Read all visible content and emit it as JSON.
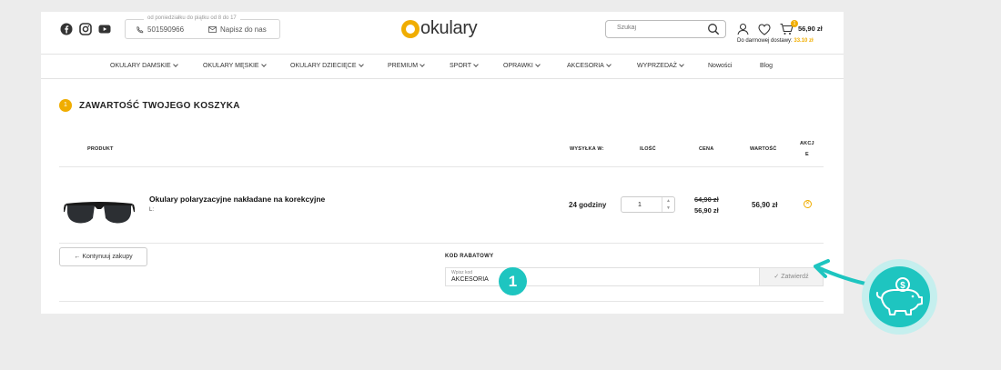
{
  "header": {
    "hours": "od poniedziałku do piątku od 8 do 17",
    "phone": "501590966",
    "mail_label": "Napisz do nas",
    "logo_text": "okulary",
    "search_placeholder": "Szukaj",
    "cart_count": "1",
    "cart_amount": "56,90 zł",
    "free_shipping_label": "Do darmowej dostawy:",
    "free_shipping_amount": "33.10 zł",
    "icons": [
      "facebook-icon",
      "instagram-icon",
      "youtube-icon",
      "phone-icon",
      "mail-icon",
      "search-icon",
      "user-icon",
      "heart-icon",
      "cart-icon"
    ]
  },
  "nav": {
    "items": [
      {
        "label": "OKULARY DAMSKIE"
      },
      {
        "label": "OKULARY MĘSKIE"
      },
      {
        "label": "OKULARY DZIECIĘCE"
      },
      {
        "label": "PREMIUM"
      },
      {
        "label": "SPORT"
      },
      {
        "label": "OPRAWKI"
      },
      {
        "label": "AKCESORIA"
      },
      {
        "label": "WYPRZEDAŻ"
      },
      {
        "label": "Nowości"
      },
      {
        "label": "Blog"
      }
    ]
  },
  "cart": {
    "step": "1",
    "title": "ZAWARTOŚĆ TWOJEGO KOSZYKA",
    "columns": {
      "product": "PRODUKT",
      "shipping": "WYSYŁKA W:",
      "qty": "ILOŚĆ",
      "price": "CENA",
      "value": "WARTOŚĆ",
      "action_1": "AKCJ",
      "action_2": "E"
    },
    "item": {
      "name": "Okulary polaryzacyjne nakładane na korekcyjne",
      "sub": "L:",
      "shipping": "24 godziny",
      "qty": "1",
      "old_price": "64,90 zł",
      "price": "56,90 zł",
      "value": "56,90 zł"
    },
    "continue_label": "← Kontynuuj zakupy"
  },
  "coupon": {
    "label": "KOD RABATOWY",
    "placeholder": "Wpisz kod",
    "value": "AKCESORIA",
    "submit_label": "✓ Zatwierdź"
  },
  "annotation": {
    "marker": "1"
  },
  "colors": {
    "accent": "#f0ad00",
    "annotation": "#1ec5c0"
  }
}
